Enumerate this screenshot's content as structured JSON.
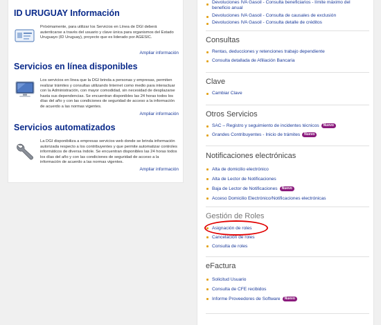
{
  "left": {
    "sections": [
      {
        "title": "ID URUGUAY Información",
        "icon": "id-card-icon",
        "description": "Próximamente, para utilizar los Servicios en Línea de DGI deberá autenticarse a través del usuario y clave única para organismos del Estado Uruguayo (ID Uruguay), proyecto que es liderado por AGESIC.",
        "link": "Ampliar información"
      },
      {
        "title": "Servicios en línea disponibles",
        "icon": "monitor-icon",
        "description": "Los servicios en línea que la DGI brinda a personas y empresas, permiten realizar trámites y consultas utilizando Internet como medio para interactuar con la Administración, con mayor comodidad, sin necesidad de desplazarse hasta sus dependencias.  Se encuentran disponibles las 24 horas todos los días del año  y con las condiciones de seguridad  de acceso a la información de acuerdo a las normas vigentes.",
        "link": "Ampliar información"
      },
      {
        "title": "Servicios automatizados",
        "icon": "wrench-icon",
        "description": "La DGI disponibiliza a empresas servicios web donde se brinda información autorizada respecto a los contribuyentes y que permite automatizar controles informáticos de diversa índole.  Se encuentran disponibles las 24 horas todos los días del año  y con las condiciones de seguridad  de acceso a la información de acuerdo a las normas vigentes.",
        "link": "Ampliar información"
      }
    ]
  },
  "right": {
    "top_items": [
      "Devoluciones IVA Gasoil - Consulta beneficiarios - límite máximo del beneficio anual",
      "Devoluciones IVA Gasoil - Consulta de causales de exclusión",
      "Devoluciones IVA Gasoil - Consulta detalle de créditos"
    ],
    "groups": [
      {
        "title": "Consultas",
        "items": [
          {
            "label": "Rentas, deducciones y retenciones trabajo dependiente"
          },
          {
            "label": "Consulta detallada de Afiliación Bancaria"
          }
        ]
      },
      {
        "title": "Clave",
        "items": [
          {
            "label": "Cambiar Clave"
          }
        ]
      },
      {
        "title": "Otros Servicios",
        "items": [
          {
            "label": "SAC – Registro y seguimiento de incidentes técnicos",
            "badge": "Nuevo"
          },
          {
            "label": "Grandes Contribuyentes - Inicio de trámites",
            "badge": "Nuevo"
          }
        ]
      },
      {
        "title": "Notificaciones electrónicas",
        "items": [
          {
            "label": "Alta de domicilio electrónico"
          },
          {
            "label": "Alta de Lector de Notificaciones"
          },
          {
            "label": "Baja de Lector de Notificaciones",
            "badge": "Nuevo"
          },
          {
            "label": "Acceso Domicilio Electrónico/Notificaciones electrónicas"
          }
        ]
      },
      {
        "title": "Gestión de Roles",
        "items": [
          {
            "label": "Asignación de roles"
          },
          {
            "label": "Cancelación de roles"
          },
          {
            "label": "Consulta de roles"
          }
        ]
      },
      {
        "title": "eFactura",
        "items": [
          {
            "label": "Solicitud Usuario"
          },
          {
            "label": "Consulta de CFE recibidos"
          },
          {
            "label": "Informe Proveedores de Software",
            "badge": "Nuevo"
          }
        ]
      }
    ]
  },
  "colors": {
    "title_blue": "#0a2a8a",
    "link_blue": "#1a3a9a",
    "bullet": "#e3a31a",
    "badge": "#8a1a7c",
    "highlight": "#e00000"
  }
}
